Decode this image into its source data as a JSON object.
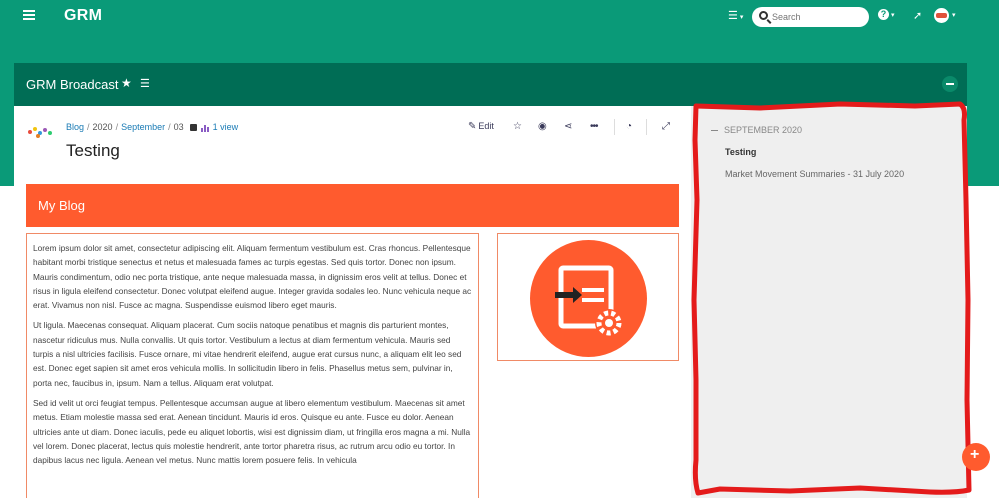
{
  "app": {
    "brand": "GRM"
  },
  "header": {
    "search_placeholder": "Search",
    "help_label": "?"
  },
  "portlet": {
    "title": "GRM Broadcast"
  },
  "entry": {
    "breadcrumb": [
      "Blog",
      "2020",
      "September",
      "03"
    ],
    "views": "1 view",
    "title": "Testing",
    "edit_label": "Edit"
  },
  "banner": {
    "title": "My Blog"
  },
  "body": {
    "paragraphs": [
      "Lorem ipsum dolor sit amet, consectetur adipiscing elit. Aliquam fermentum vestibulum est. Cras rhoncus. Pellentesque habitant morbi tristique senectus et netus et malesuada fames ac turpis egestas. Sed quis tortor. Donec non ipsum. Mauris condimentum, odio nec porta tristique, ante neque malesuada massa, in dignissim eros velit at tellus. Donec et risus in ligula eleifend consectetur. Donec volutpat eleifend augue. Integer gravida sodales leo. Nunc vehicula neque ac erat. Vivamus non nisl. Fusce ac magna. Suspendisse euismod libero eget mauris.",
      "Ut ligula. Maecenas consequat. Aliquam placerat. Cum sociis natoque penatibus et magnis dis parturient montes, nascetur ridiculus mus. Nulla convallis. Ut quis tortor. Vestibulum a lectus at diam fermentum vehicula. Mauris sed turpis a nisl ultricies facilisis. Fusce ornare, mi vitae hendrerit eleifend, augue erat cursus nunc, a aliquam elit leo sed est. Donec eget sapien sit amet eros vehicula mollis. In sollicitudin libero in felis. Phasellus metus sem, pulvinar in, porta nec, faucibus in, ipsum. Nam a tellus. Aliquam erat volutpat.",
      "Sed id velit ut orci feugiat tempus. Pellentesque accumsan augue at libero elementum vestibulum. Maecenas sit amet metus. Etiam molestie massa sed erat. Aenean tincidunt. Mauris id eros. Quisque eu ante. Fusce eu dolor. Aenean ultricies ante ut diam. Donec iaculis, pede eu aliquet lobortis, wisi est dignissim diam, ut fringilla eros magna a mi. Nulla vel lorem. Donec placerat, lectus quis molestie hendrerit, ante tortor pharetra risus, ac rutrum arcu odio eu tortor. In dapibus lacus nec ligula. Aenean vel metus. Nunc mattis lorem posuere felis. In vehicula"
    ]
  },
  "sidebar": {
    "group_label": "SEPTEMBER 2020",
    "items": [
      {
        "label": "Testing",
        "active": true
      },
      {
        "label": "Market Movement Summaries - 31 July 2020",
        "active": false
      }
    ]
  },
  "fab": {
    "label": "+"
  },
  "colors": {
    "brand_green": "#0a9a78",
    "portlet_green": "#006d55",
    "accent_orange": "#ff5b2e",
    "annotation_red": "#e41b1b"
  },
  "icons": [
    "menu-icon",
    "list-icon",
    "search-icon",
    "help-icon",
    "rocket-icon",
    "star-icon",
    "lock-icon",
    "bar-chart-icon",
    "pencil-icon",
    "eye-icon",
    "share-icon",
    "more-icon",
    "rss-icon",
    "expand-icon",
    "document-settings-icon"
  ]
}
